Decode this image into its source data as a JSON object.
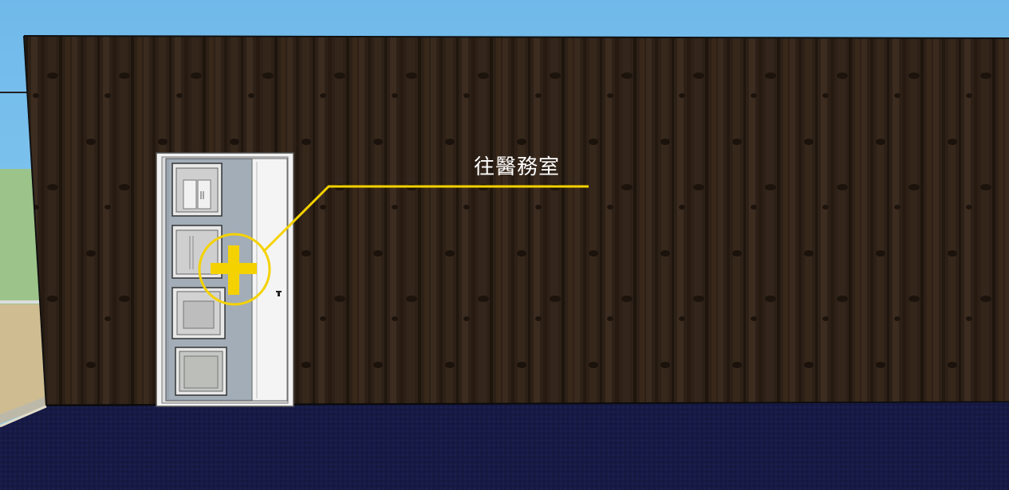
{
  "signage": {
    "direction_label": "往醫務室"
  },
  "colors": {
    "sky": "#7ec3ec",
    "wall_wood": "#2e2118",
    "floor_carpet": "#161a45",
    "accent_line": "#f4d200",
    "door_frame": "#e6e6e6",
    "cabinet_back": "#9aa4ae"
  },
  "icons": {
    "medical": "medical-cross-icon"
  }
}
